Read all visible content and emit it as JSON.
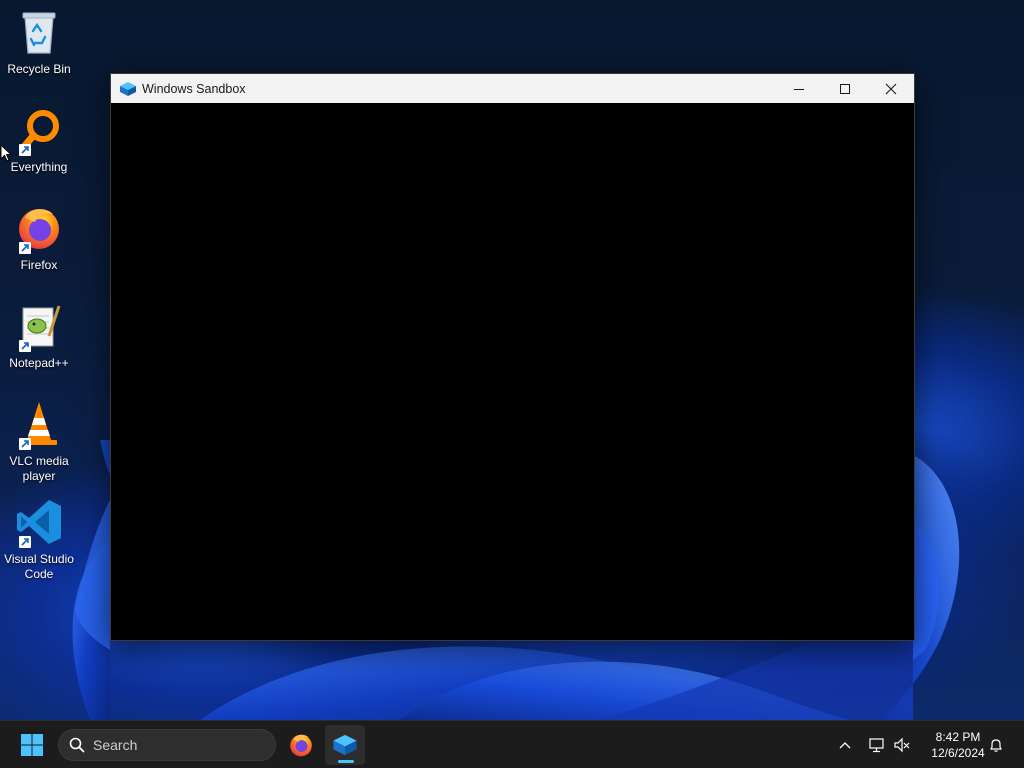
{
  "desktop": {
    "icons": [
      {
        "label": "Recycle Bin",
        "icon": "recycle-bin-icon"
      },
      {
        "label": "Everything",
        "icon": "everything-search-icon",
        "shortcut": true
      },
      {
        "label": "Firefox",
        "icon": "firefox-icon",
        "shortcut": true
      },
      {
        "label": "Notepad++",
        "icon": "notepadpp-icon",
        "shortcut": true
      },
      {
        "label": "VLC media player",
        "icon": "vlc-icon",
        "shortcut": true
      },
      {
        "label": "Visual Studio Code",
        "icon": "vscode-icon",
        "shortcut": true
      }
    ]
  },
  "window": {
    "title": "Windows Sandbox",
    "icon": "windows-sandbox-icon",
    "controls": [
      "minimize",
      "maximize",
      "close"
    ]
  },
  "taskbar": {
    "search_placeholder": "Search",
    "pinned": [
      {
        "name": "start",
        "icon": "windows-start-icon"
      },
      {
        "name": "firefox",
        "icon": "firefox-icon"
      },
      {
        "name": "windows-sandbox",
        "icon": "windows-sandbox-icon",
        "active": true
      }
    ],
    "time": "8:42 PM",
    "date": "12/6/2024"
  },
  "colors": {
    "accent": "#4cc2ff",
    "taskbar": "#1c1c1c",
    "titlebar": "#f3f3f3"
  }
}
